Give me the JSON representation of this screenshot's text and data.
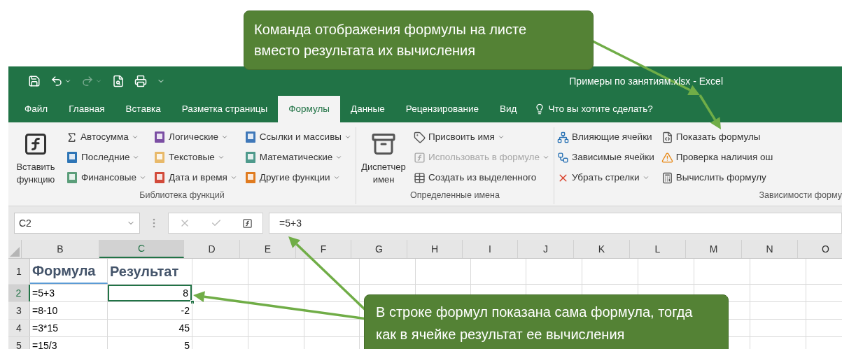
{
  "window": {
    "title": "Примеры по занятиям.xlsx - Excel"
  },
  "tabs": [
    {
      "label": "Файл",
      "selected": false
    },
    {
      "label": "Главная",
      "selected": false
    },
    {
      "label": "Вставка",
      "selected": false
    },
    {
      "label": "Разметка страницы",
      "selected": false
    },
    {
      "label": "Формулы",
      "selected": true
    },
    {
      "label": "Данные",
      "selected": false
    },
    {
      "label": "Рецензирование",
      "selected": false
    },
    {
      "label": "Вид",
      "selected": false
    }
  ],
  "tell_me": {
    "placeholder": "Что вы хотите сделать?"
  },
  "ribbon": {
    "groups": [
      {
        "label": "Библиотека функций",
        "big_button": {
          "label": "Вставить функцию"
        },
        "columns": [
          [
            {
              "label": "Автосумма",
              "dropdown": true,
              "disabled": false
            },
            {
              "label": "Последние",
              "dropdown": true,
              "disabled": false
            },
            {
              "label": "Финансовые",
              "dropdown": true,
              "disabled": false
            }
          ],
          [
            {
              "label": "Логические",
              "dropdown": true,
              "disabled": false
            },
            {
              "label": "Текстовые",
              "dropdown": true,
              "disabled": false
            },
            {
              "label": "Дата и время",
              "dropdown": true,
              "disabled": false
            }
          ],
          [
            {
              "label": "Ссылки и массивы",
              "dropdown": true,
              "disabled": false
            },
            {
              "label": "Математические",
              "dropdown": true,
              "disabled": false
            },
            {
              "label": "Другие функции",
              "dropdown": true,
              "disabled": false
            }
          ]
        ]
      },
      {
        "label": "Определенные имена",
        "big_button": {
          "label": "Диспетчер имен"
        },
        "columns": [
          [
            {
              "label": "Присвоить имя",
              "dropdown": true,
              "disabled": false
            },
            {
              "label": "Использовать в формуле",
              "dropdown": true,
              "disabled": true
            },
            {
              "label": "Создать из выделенного",
              "dropdown": false,
              "disabled": false
            }
          ]
        ]
      },
      {
        "label": "Зависимости форму",
        "columns": [
          [
            {
              "label": "Влияющие ячейки",
              "dropdown": false,
              "disabled": false
            },
            {
              "label": "Зависимые ячейки",
              "dropdown": false,
              "disabled": false
            },
            {
              "label": "Убрать стрелки",
              "dropdown": true,
              "disabled": false
            }
          ],
          [
            {
              "label": "Показать формулы",
              "dropdown": false,
              "disabled": false
            },
            {
              "label": "Проверка наличия ош",
              "dropdown": false,
              "disabled": false
            },
            {
              "label": "Вычислить формулу",
              "dropdown": false,
              "disabled": false
            }
          ]
        ]
      }
    ]
  },
  "formula_bar": {
    "name_box": "C2",
    "formula": "=5+3"
  },
  "grid": {
    "columns": [
      {
        "label": "B",
        "selected": false
      },
      {
        "label": "C",
        "selected": true
      },
      {
        "label": "D",
        "selected": false
      },
      {
        "label": "E",
        "selected": false
      },
      {
        "label": "F",
        "selected": false
      },
      {
        "label": "G",
        "selected": false
      },
      {
        "label": "H",
        "selected": false
      },
      {
        "label": "I",
        "selected": false
      },
      {
        "label": "J",
        "selected": false
      },
      {
        "label": "K",
        "selected": false
      },
      {
        "label": "L",
        "selected": false
      },
      {
        "label": "M",
        "selected": false
      },
      {
        "label": "N",
        "selected": false
      },
      {
        "label": "O",
        "selected": false
      }
    ],
    "rows": [
      {
        "label": "1",
        "kind": "header",
        "selected": false,
        "cells": [
          {
            "text": "Формула",
            "selected": false
          },
          {
            "text": "Результат",
            "selected": false
          }
        ]
      },
      {
        "label": "2",
        "kind": "data",
        "selected": true,
        "cells": [
          {
            "text": "=5+3",
            "selected": false
          },
          {
            "text": "8",
            "selected": true
          }
        ]
      },
      {
        "label": "3",
        "kind": "data",
        "selected": false,
        "cells": [
          {
            "text": "=8-10",
            "selected": false
          },
          {
            "text": "-2",
            "selected": false
          }
        ]
      },
      {
        "label": "4",
        "kind": "data",
        "selected": false,
        "cells": [
          {
            "text": "=3*15",
            "selected": false
          },
          {
            "text": "45",
            "selected": false
          }
        ]
      },
      {
        "label": "5",
        "kind": "data",
        "selected": false,
        "cells": [
          {
            "text": "=15/3",
            "selected": false
          },
          {
            "text": "5",
            "selected": false
          }
        ]
      }
    ]
  },
  "callouts": [
    {
      "text": "Команда отображения формулы на листе вместо результата их вычисления"
    },
    {
      "text": "В строке формул показана сама формула, тогда как в ячейке результат ее вычисления"
    }
  ]
}
